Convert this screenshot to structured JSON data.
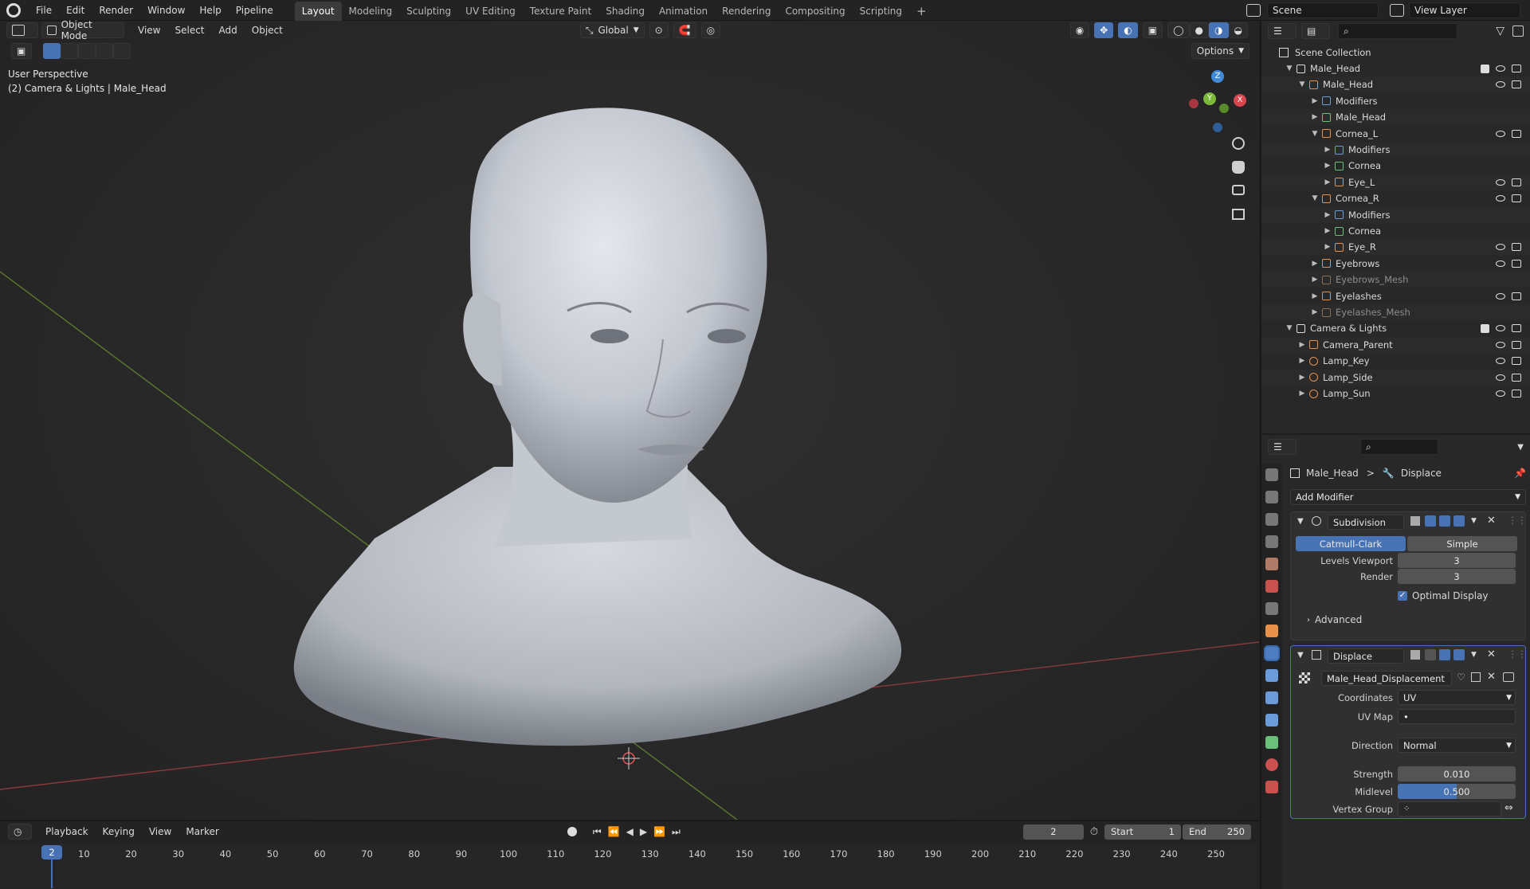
{
  "menu": [
    "File",
    "Edit",
    "Render",
    "Window",
    "Help",
    "Pipeline"
  ],
  "workspaces": [
    "Layout",
    "Modeling",
    "Sculpting",
    "UV Editing",
    "Texture Paint",
    "Shading",
    "Animation",
    "Rendering",
    "Compositing",
    "Scripting"
  ],
  "active_workspace": "Layout",
  "add_workspace": "+",
  "scene": {
    "name": "Scene",
    "view_layer": "View Layer"
  },
  "viewport": {
    "mode": "Object Mode",
    "menus": [
      "View",
      "Select",
      "Add",
      "Object"
    ],
    "transform": "Global",
    "options": "Options",
    "perspective": "User Perspective",
    "info": "(2) Camera & Lights | Male_Head",
    "gizmo": {
      "z": "Z",
      "y": "Y",
      "x": "X"
    }
  },
  "outliner": {
    "root": "Scene Collection",
    "rows": [
      {
        "label": "Male_Head",
        "indent": 1,
        "open": true,
        "kind": "collection"
      },
      {
        "label": "Male_Head",
        "indent": 2,
        "open": true,
        "kind": "object"
      },
      {
        "label": "Modifiers",
        "indent": 3,
        "open": false,
        "kind": "modifiers"
      },
      {
        "label": "Male_Head",
        "indent": 3,
        "open": false,
        "kind": "mesh"
      },
      {
        "label": "Cornea_L",
        "indent": 3,
        "open": true,
        "kind": "object"
      },
      {
        "label": "Modifiers",
        "indent": 4,
        "open": false,
        "kind": "modifiers"
      },
      {
        "label": "Cornea",
        "indent": 4,
        "open": false,
        "kind": "mesh"
      },
      {
        "label": "Eye_L",
        "indent": 4,
        "open": false,
        "kind": "object"
      },
      {
        "label": "Cornea_R",
        "indent": 3,
        "open": true,
        "kind": "object"
      },
      {
        "label": "Modifiers",
        "indent": 4,
        "open": false,
        "kind": "modifiers"
      },
      {
        "label": "Cornea",
        "indent": 4,
        "open": false,
        "kind": "mesh"
      },
      {
        "label": "Eye_R",
        "indent": 4,
        "open": false,
        "kind": "object"
      },
      {
        "label": "Eyebrows",
        "indent": 3,
        "open": false,
        "kind": "curve"
      },
      {
        "label": "Eyebrows_Mesh",
        "indent": 3,
        "open": false,
        "kind": "object-dim"
      },
      {
        "label": "Eyelashes",
        "indent": 3,
        "open": false,
        "kind": "curve"
      },
      {
        "label": "Eyelashes_Mesh",
        "indent": 3,
        "open": false,
        "kind": "object-dim"
      },
      {
        "label": "Camera & Lights",
        "indent": 1,
        "open": true,
        "kind": "collection"
      },
      {
        "label": "Camera_Parent",
        "indent": 2,
        "open": false,
        "kind": "empty"
      },
      {
        "label": "Lamp_Key",
        "indent": 2,
        "open": false,
        "kind": "light"
      },
      {
        "label": "Lamp_Side",
        "indent": 2,
        "open": false,
        "kind": "light"
      },
      {
        "label": "Lamp_Sun",
        "indent": 2,
        "open": false,
        "kind": "light"
      }
    ]
  },
  "properties": {
    "breadcrumb_object": "Male_Head",
    "breadcrumb_sep": ">",
    "breadcrumb_modifier": "Displace",
    "add_modifier": "Add Modifier",
    "subdivision": {
      "name": "Subdivision",
      "type_a": "Catmull-Clark",
      "type_b": "Simple",
      "levels_viewport_label": "Levels Viewport",
      "levels_viewport": "3",
      "render_label": "Render",
      "render": "3",
      "optimal_display": "Optimal Display",
      "advanced": "Advanced"
    },
    "displace": {
      "name": "Displace",
      "texture": "Male_Head_Displacement",
      "coordinates_label": "Coordinates",
      "coordinates": "UV",
      "uvmap_label": "UV Map",
      "uvmap": "•",
      "direction_label": "Direction",
      "direction": "Normal",
      "strength_label": "Strength",
      "strength": "0.010",
      "midlevel_label": "Midlevel",
      "midlevel": "0.500",
      "midlevel_fraction": 0.5,
      "vertex_group_label": "Vertex Group"
    }
  },
  "timeline": {
    "menus": [
      "Playback",
      "Keying",
      "View",
      "Marker"
    ],
    "current_frame": "2",
    "start_label": "Start",
    "start": "1",
    "end_label": "End",
    "end": "250",
    "ruler": [
      "10",
      "20",
      "30",
      "40",
      "50",
      "60",
      "70",
      "80",
      "90",
      "100",
      "110",
      "120",
      "130",
      "140",
      "150",
      "160",
      "170",
      "180",
      "190",
      "200",
      "210",
      "220",
      "230",
      "240",
      "250"
    ]
  },
  "colors": {
    "accent": "#4772b3",
    "object_orange": "#e6904a",
    "mesh_green": "#6bc07a",
    "modifier_blue": "#6b9bd8",
    "axis_x": "#d9454d",
    "axis_y": "#7cb83a",
    "axis_z": "#3f8ad9"
  }
}
